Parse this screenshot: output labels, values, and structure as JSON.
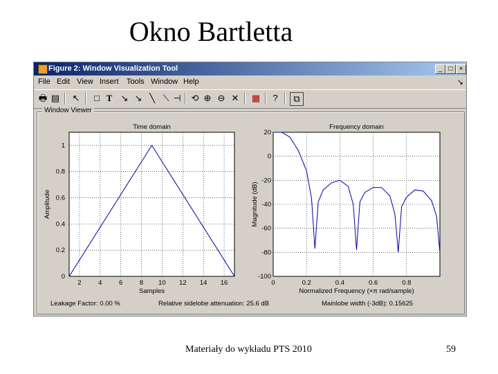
{
  "slide": {
    "title": "Okno Bartletta",
    "footer": "Materiały do wykładu PTS 2010",
    "page_number": "59"
  },
  "window": {
    "title": "Figure 2: Window Visualization Tool",
    "controls": [
      "_",
      "□",
      "×"
    ],
    "menu": [
      "File",
      "Edit",
      "View",
      "Insert",
      "Tools",
      "Window",
      "Help"
    ],
    "menu_arrow": "↘",
    "toolbar": [
      "print-icon",
      "save-icon",
      "pointer-icon",
      "rectangle-icon",
      "text-icon",
      "arrow-icon",
      "arrow-icon",
      "line-icon",
      "line-icon",
      "rotate-icon",
      "zoom-in-icon",
      "zoom-out-icon",
      "zoom-reset-icon",
      "legend-icon",
      "help-icon",
      "dock-icon"
    ]
  },
  "viewer": {
    "panel_title": "Window Viewer",
    "leakage": "Leakage Factor: 0.00 %",
    "sidelobe": "Relative sidelobe attenuation: 25.6 dB",
    "mainlobe": "Mainlobe width (-3dB): 0.15625"
  },
  "chart_data": [
    {
      "type": "line",
      "title": "Time domain",
      "xlabel": "Samples",
      "ylabel": "Amplitude",
      "xlim": [
        1,
        17
      ],
      "ylim": [
        0,
        1.1
      ],
      "xticks": [
        2,
        4,
        6,
        8,
        10,
        12,
        14,
        16
      ],
      "yticks": [
        0,
        0.2,
        0.4,
        0.6,
        0.8,
        1
      ],
      "grid": true,
      "color": "#0000a0",
      "x": [
        1,
        9,
        17
      ],
      "y": [
        0,
        1,
        0
      ]
    },
    {
      "type": "line",
      "title": "Frequency domain",
      "xlabel": "Normalized Frequency (×π rad/sample)",
      "ylabel": "Magnitude (dB)",
      "xlim": [
        0,
        1
      ],
      "ylim": [
        -100,
        20
      ],
      "xticks": [
        0,
        0.2,
        0.4,
        0.6,
        0.8
      ],
      "yticks": [
        20,
        0,
        -20,
        -40,
        -60,
        -80,
        -100
      ],
      "grid": true,
      "color": "#0000a0",
      "x": [
        0,
        0.05,
        0.1,
        0.15,
        0.2,
        0.23,
        0.25,
        0.27,
        0.3,
        0.35,
        0.4,
        0.45,
        0.48,
        0.5,
        0.52,
        0.55,
        0.6,
        0.65,
        0.7,
        0.73,
        0.75,
        0.77,
        0.8,
        0.85,
        0.9,
        0.95,
        0.98,
        1.0
      ],
      "y": [
        24,
        22,
        16,
        5,
        -12,
        -35,
        -77,
        -38,
        -28,
        -22,
        -20,
        -25,
        -40,
        -78,
        -38,
        -30,
        -26,
        -26,
        -33,
        -48,
        -80,
        -42,
        -34,
        -28,
        -29,
        -37,
        -50,
        -80
      ]
    }
  ]
}
